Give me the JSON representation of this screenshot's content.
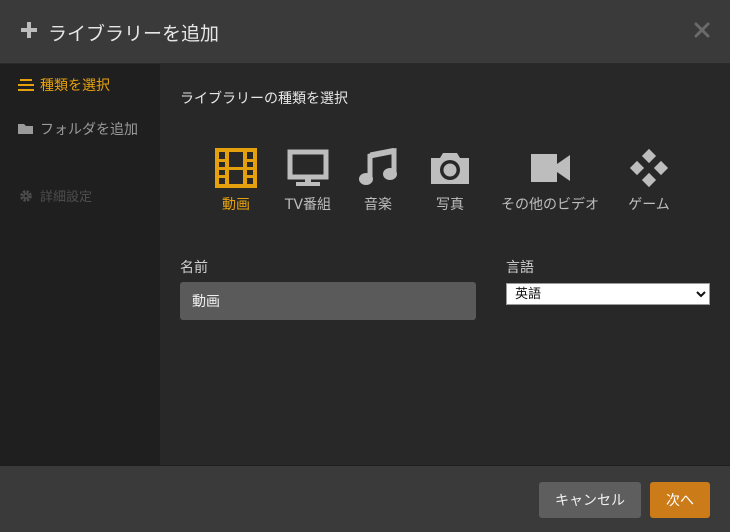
{
  "header": {
    "title": "ライブラリーを追加"
  },
  "sidebar": {
    "items": [
      {
        "label": "種類を選択",
        "state": "active"
      },
      {
        "label": "フォルダを追加",
        "state": "normal"
      },
      {
        "label": "詳細設定",
        "state": "disabled"
      }
    ]
  },
  "main": {
    "section_title": "ライブラリーの種類を選択",
    "types": [
      {
        "label": "動画",
        "icon": "film-icon",
        "selected": true
      },
      {
        "label": "TV番組",
        "icon": "tv-icon",
        "selected": false
      },
      {
        "label": "音楽",
        "icon": "music-note-icon",
        "selected": false
      },
      {
        "label": "写真",
        "icon": "camera-icon",
        "selected": false
      },
      {
        "label": "その他のビデオ",
        "icon": "video-camera-icon",
        "selected": false
      },
      {
        "label": "ゲーム",
        "icon": "gamepad-icon",
        "selected": false
      }
    ],
    "name_label": "名前",
    "name_value": "動画",
    "language_label": "言語",
    "language_value": "英語"
  },
  "footer": {
    "cancel_label": "キャンセル",
    "next_label": "次へ"
  },
  "colors": {
    "accent": "#e5a00d",
    "next_button": "#cc7b19",
    "icon_gray": "#bdbdbd"
  }
}
